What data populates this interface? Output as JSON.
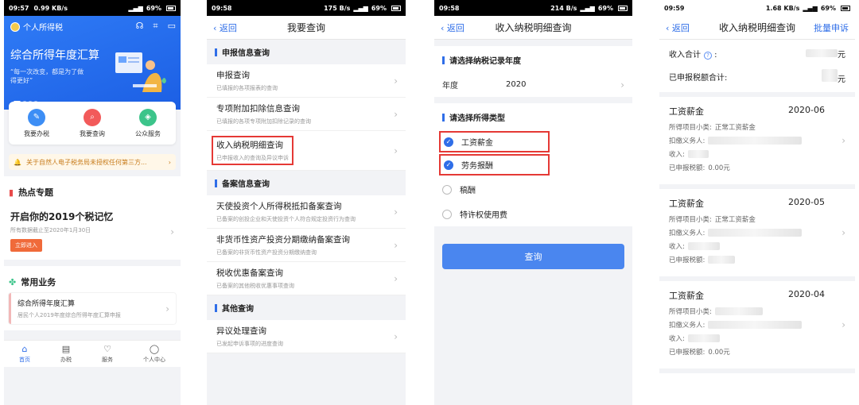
{
  "phone1": {
    "status": {
      "time": "09:57",
      "speed": "0.99 KB/s",
      "battery": "69%"
    },
    "brand": "个人所得税",
    "hero": {
      "title": "综合所得年度汇算",
      "subtitle": "“每一次改变，都是为了做得更好”"
    },
    "quick": [
      {
        "label": "我要办税",
        "color": "#3d8ef5"
      },
      {
        "label": "我要查询",
        "color": "#f25a5a"
      },
      {
        "label": "公众服务",
        "color": "#3cc48a"
      }
    ],
    "notice": "关于自然人电子税务局未授权任何第三方...",
    "hot": {
      "heading": "热点专题",
      "card_title": "开启你的2019个税记忆",
      "card_sub": "所有数据截止至2020年1月30日",
      "button": "立即进入"
    },
    "common": {
      "heading": "常用业务",
      "card_title": "综合所得年度汇算",
      "card_sub": "居民个人2019年度综合所得年度汇算申报"
    },
    "tabs": [
      {
        "label": "首页",
        "icon": "⌂"
      },
      {
        "label": "办税",
        "icon": "▤"
      },
      {
        "label": "服务",
        "icon": "♡"
      },
      {
        "label": "个人中心",
        "icon": "◯"
      }
    ]
  },
  "phone2": {
    "status": {
      "time": "09:58",
      "speed": "175 B/s",
      "battery": "69%"
    },
    "nav": {
      "back": "返回",
      "title": "我要查询"
    },
    "sections": [
      {
        "title": "申报信息查询",
        "items": [
          {
            "t": "申报查询",
            "s": "已填报的各项报表的查询"
          },
          {
            "t": "专项附加扣除信息查询",
            "s": "已填报的各项专项附加扣除记录的查询"
          },
          {
            "t": "收入纳税明细查询",
            "s": "已申报收入的查询及异议申诉"
          }
        ]
      },
      {
        "title": "备案信息查询",
        "items": [
          {
            "t": "天使投资个人所得税抵扣备案查询",
            "s": "已备案的创投企业和天使投资个人符合规定投资行为查询"
          },
          {
            "t": "非货币性资产投资分期缴纳备案查询",
            "s": "已备案的非货币性资产投资分期缴纳查询"
          },
          {
            "t": "税收优惠备案查询",
            "s": "已备案的其他税收优惠事项查询"
          }
        ]
      },
      {
        "title": "其他查询",
        "items": [
          {
            "t": "异议处理查询",
            "s": "已发起申诉事项的进度查询"
          }
        ]
      }
    ]
  },
  "phone3": {
    "status": {
      "time": "09:58",
      "speed": "214 B/s",
      "battery": "69%"
    },
    "nav": {
      "back": "返回",
      "title": "收入纳税明细查询"
    },
    "year_section": {
      "title": "请选择纳税记录年度",
      "label": "年度",
      "value": "2020"
    },
    "type_section": {
      "title": "请选择所得类型",
      "options": [
        {
          "label": "工资薪金",
          "checked": true
        },
        {
          "label": "劳务报酬",
          "checked": true
        },
        {
          "label": "稿酬",
          "checked": false
        },
        {
          "label": "特许权使用费",
          "checked": false
        }
      ]
    },
    "button": "查询"
  },
  "phone4": {
    "status": {
      "time": "09:59",
      "speed": "1.68 KB/s",
      "battery": "69%"
    },
    "nav": {
      "back": "返回",
      "title": "收入纳税明细查询",
      "action": "批量申诉"
    },
    "summary": {
      "income_label": "收入合计",
      "tax_label": "已申报税额合计:",
      "suffix": "元"
    },
    "records": [
      {
        "category": "工资薪金",
        "date": "2020-06",
        "sub_label": "所得项目小类:",
        "sub_value": "正常工资薪金",
        "payer_label": "扣缴义务人:",
        "income_label": "收入:",
        "tax_label": "已申报税额:",
        "tax_value": "0.00元"
      },
      {
        "category": "工资薪金",
        "date": "2020-05",
        "sub_label": "所得项目小类:",
        "sub_value": "正常工资薪金",
        "payer_label": "扣缴义务人:",
        "income_label": "收入:",
        "tax_label": "已申报税额:",
        "tax_value": ""
      },
      {
        "category": "工资薪金",
        "date": "2020-04",
        "sub_label": "所得项目小类:",
        "sub_value": "",
        "payer_label": "扣缴义务人:",
        "income_label": "收入:",
        "tax_label": "已申报税额:",
        "tax_value": "0.00元"
      }
    ]
  }
}
